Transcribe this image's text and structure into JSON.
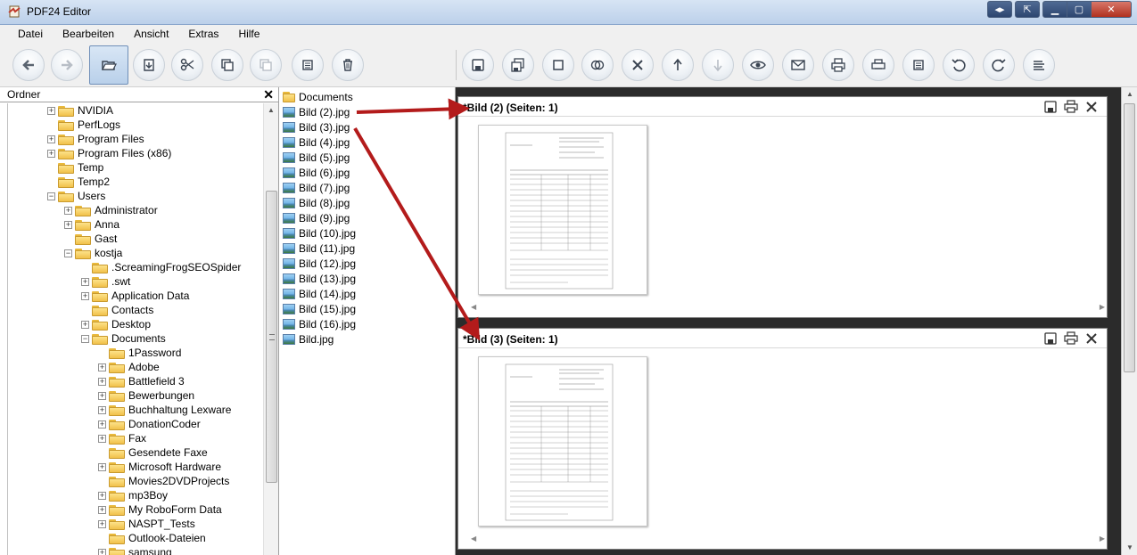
{
  "window": {
    "title": "PDF24 Editor"
  },
  "menu": [
    "Datei",
    "Bearbeiten",
    "Ansicht",
    "Extras",
    "Hilfe"
  ],
  "toolbar_icons": [
    "back-icon",
    "forward-icon",
    "open-folder-icon",
    "import-icon",
    "cut-icon",
    "copy-icon",
    "paste-icon",
    "calculator-icon",
    "delete-icon",
    "save-icon",
    "save-all-icon",
    "rectangle-icon",
    "merge-icon",
    "remove-icon",
    "move-up-icon",
    "move-down-icon",
    "preview-icon",
    "email-icon",
    "print-icon",
    "print-all-icon",
    "calc-icon",
    "rotate-left-icon",
    "rotate-right-icon",
    "align-icon"
  ],
  "folder_panel": {
    "header": "Ordner",
    "close_label": "✕",
    "tree": [
      {
        "label": "NVIDIA",
        "level": 2,
        "exp": "+"
      },
      {
        "label": "PerfLogs",
        "level": 2,
        "exp": ""
      },
      {
        "label": "Program Files",
        "level": 2,
        "exp": "+"
      },
      {
        "label": "Program Files (x86)",
        "level": 2,
        "exp": "+"
      },
      {
        "label": "Temp",
        "level": 2,
        "exp": ""
      },
      {
        "label": "Temp2",
        "level": 2,
        "exp": ""
      },
      {
        "label": "Users",
        "level": 2,
        "exp": "−"
      },
      {
        "label": "Administrator",
        "level": 3,
        "exp": "+"
      },
      {
        "label": "Anna",
        "level": 3,
        "exp": "+"
      },
      {
        "label": "Gast",
        "level": 3,
        "exp": ""
      },
      {
        "label": "kostja",
        "level": 3,
        "exp": "−"
      },
      {
        "label": ".ScreamingFrogSEOSpider",
        "level": 4,
        "exp": ""
      },
      {
        "label": ".swt",
        "level": 4,
        "exp": "+"
      },
      {
        "label": "Application Data",
        "level": 4,
        "exp": "+"
      },
      {
        "label": "Contacts",
        "level": 4,
        "exp": ""
      },
      {
        "label": "Desktop",
        "level": 4,
        "exp": "+"
      },
      {
        "label": "Documents",
        "level": 4,
        "exp": "−"
      },
      {
        "label": "1Password",
        "level": 5,
        "exp": ""
      },
      {
        "label": "Adobe",
        "level": 5,
        "exp": "+"
      },
      {
        "label": "Battlefield 3",
        "level": 5,
        "exp": "+"
      },
      {
        "label": "Bewerbungen",
        "level": 5,
        "exp": "+"
      },
      {
        "label": "Buchhaltung Lexware",
        "level": 5,
        "exp": "+"
      },
      {
        "label": "DonationCoder",
        "level": 5,
        "exp": "+"
      },
      {
        "label": "Fax",
        "level": 5,
        "exp": "+"
      },
      {
        "label": "Gesendete Faxe",
        "level": 5,
        "exp": ""
      },
      {
        "label": "Microsoft Hardware",
        "level": 5,
        "exp": "+"
      },
      {
        "label": "Movies2DVDProjects",
        "level": 5,
        "exp": ""
      },
      {
        "label": "mp3Boy",
        "level": 5,
        "exp": "+"
      },
      {
        "label": "My RoboForm Data",
        "level": 5,
        "exp": "+"
      },
      {
        "label": "NASPT_Tests",
        "level": 5,
        "exp": "+"
      },
      {
        "label": "Outlook-Dateien",
        "level": 5,
        "exp": ""
      },
      {
        "label": "samsung",
        "level": 5,
        "exp": "+"
      }
    ]
  },
  "file_list": [
    {
      "label": "Documents",
      "type": "folder"
    },
    {
      "label": "Bild (2).jpg",
      "type": "image"
    },
    {
      "label": "Bild (3).jpg",
      "type": "image"
    },
    {
      "label": "Bild (4).jpg",
      "type": "image"
    },
    {
      "label": "Bild (5).jpg",
      "type": "image"
    },
    {
      "label": "Bild (6).jpg",
      "type": "image"
    },
    {
      "label": "Bild (7).jpg",
      "type": "image"
    },
    {
      "label": "Bild (8).jpg",
      "type": "image"
    },
    {
      "label": "Bild (9).jpg",
      "type": "image"
    },
    {
      "label": "Bild (10).jpg",
      "type": "image"
    },
    {
      "label": "Bild (11).jpg",
      "type": "image"
    },
    {
      "label": "Bild (12).jpg",
      "type": "image"
    },
    {
      "label": "Bild (13).jpg",
      "type": "image"
    },
    {
      "label": "Bild (14).jpg",
      "type": "image"
    },
    {
      "label": "Bild (15).jpg",
      "type": "image"
    },
    {
      "label": "Bild (16).jpg",
      "type": "image"
    },
    {
      "label": "Bild.jpg",
      "type": "image"
    }
  ],
  "documents": [
    {
      "title": "*Bild (2) (Seiten: 1)"
    },
    {
      "title": "*Bild (3) (Seiten: 1)"
    }
  ],
  "colors": {
    "arrow": "#b31b1b",
    "doc_background": "#2b2b2b",
    "title_bar": "#c7d8ee"
  }
}
